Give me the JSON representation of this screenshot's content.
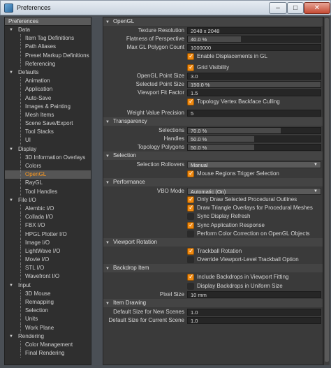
{
  "window": {
    "title": "Preferences",
    "min": "–",
    "max": "□",
    "close": "✕"
  },
  "sidebar": {
    "header": "Preferences",
    "tree": [
      {
        "label": "Data",
        "kind": "group"
      },
      {
        "label": "Item Tag Definitions",
        "kind": "child"
      },
      {
        "label": "Path Aliases",
        "kind": "child"
      },
      {
        "label": "Preset Markup Definitions",
        "kind": "child"
      },
      {
        "label": "Referencing",
        "kind": "child"
      },
      {
        "label": "Defaults",
        "kind": "group"
      },
      {
        "label": "Animation",
        "kind": "child"
      },
      {
        "label": "Application",
        "kind": "child"
      },
      {
        "label": "Auto-Save",
        "kind": "child"
      },
      {
        "label": "Images & Painting",
        "kind": "child"
      },
      {
        "label": "Mesh Items",
        "kind": "child"
      },
      {
        "label": "Scene Save/Export",
        "kind": "child"
      },
      {
        "label": "Tool Stacks",
        "kind": "child"
      },
      {
        "label": "UI",
        "kind": "child"
      },
      {
        "label": "Display",
        "kind": "group"
      },
      {
        "label": "3D Information Overlays",
        "kind": "child"
      },
      {
        "label": "Colors",
        "kind": "child"
      },
      {
        "label": "OpenGL",
        "kind": "child",
        "selected": true
      },
      {
        "label": "RayGL",
        "kind": "child"
      },
      {
        "label": "Tool Handles",
        "kind": "child"
      },
      {
        "label": "File I/O",
        "kind": "group"
      },
      {
        "label": "Alembic I/O",
        "kind": "child"
      },
      {
        "label": "Collada I/O",
        "kind": "child"
      },
      {
        "label": "FBX I/O",
        "kind": "child"
      },
      {
        "label": "HPGL Plotter I/O",
        "kind": "child"
      },
      {
        "label": "Image I/O",
        "kind": "child"
      },
      {
        "label": "LightWave I/O",
        "kind": "child"
      },
      {
        "label": "Movie I/O",
        "kind": "child"
      },
      {
        "label": "STL I/O",
        "kind": "child"
      },
      {
        "label": "Wavefront I/O",
        "kind": "child"
      },
      {
        "label": "Input",
        "kind": "group"
      },
      {
        "label": "3D Mouse",
        "kind": "child"
      },
      {
        "label": "Remapping",
        "kind": "child"
      },
      {
        "label": "Selection",
        "kind": "child"
      },
      {
        "label": "Units",
        "kind": "child"
      },
      {
        "label": "Work Plane",
        "kind": "child"
      },
      {
        "label": "Rendering",
        "kind": "group"
      },
      {
        "label": "Color Management",
        "kind": "child"
      },
      {
        "label": "Final Rendering",
        "kind": "child"
      }
    ]
  },
  "content": {
    "sections": [
      {
        "title": "OpenGL",
        "rows": [
          {
            "type": "field",
            "label": "Texture Resolution",
            "value": "2048 x 2048"
          },
          {
            "type": "pct",
            "label": "Flatness of Perspective",
            "value": "40.0 %",
            "fill": 0.4
          },
          {
            "type": "field",
            "label": "Max GL Polygon Count",
            "value": "1000000"
          },
          {
            "type": "check",
            "label": "Enable Displacements in GL",
            "checked": true
          },
          {
            "type": "gap"
          },
          {
            "type": "check",
            "label": "Grid Visibility",
            "checked": true
          },
          {
            "type": "field",
            "label": "OpenGL Point Size",
            "value": "3.0"
          },
          {
            "type": "pct",
            "label": "Selected Point Size",
            "value": "150.0 %",
            "fill": 1.0
          },
          {
            "type": "field",
            "label": "Viewport Fit Factor",
            "value": "1.5"
          },
          {
            "type": "check",
            "label": "Topology Vertex Backface Culling",
            "checked": true
          },
          {
            "type": "gap"
          },
          {
            "type": "field",
            "label": "Weight Value Precision",
            "value": "5"
          }
        ]
      },
      {
        "title": "Transparency",
        "rows": [
          {
            "type": "pct",
            "label": "Selections",
            "value": "70.0 %",
            "fill": 0.7
          },
          {
            "type": "pct",
            "label": "Handles",
            "value": "50.0 %",
            "fill": 0.5
          },
          {
            "type": "pct",
            "label": "Topology Polygons",
            "value": "50.0 %",
            "fill": 0.5
          }
        ]
      },
      {
        "title": "Selection",
        "rows": [
          {
            "type": "dropdown",
            "label": "Selection Rollovers",
            "value": "Manual"
          },
          {
            "type": "check",
            "label": "Mouse Regions Trigger Selection",
            "checked": true
          }
        ]
      },
      {
        "title": "Performance",
        "rows": [
          {
            "type": "dropdown",
            "label": "VBO Mode",
            "value": "Automatic (On)"
          },
          {
            "type": "check",
            "label": "Only Draw Selected Procedural Outlines",
            "checked": true
          },
          {
            "type": "check",
            "label": "Draw Triangle Overlays for Procedural Meshes",
            "checked": true
          },
          {
            "type": "check",
            "label": "Sync Display Refresh",
            "checked": false
          },
          {
            "type": "check",
            "label": "Sync Application Response",
            "checked": true
          },
          {
            "type": "check",
            "label": "Perform Color Correction on OpenGL Objects",
            "checked": false
          }
        ]
      },
      {
        "title": "Viewport Rotation",
        "rows": [
          {
            "type": "check",
            "label": "Trackball Rotation",
            "checked": true
          },
          {
            "type": "check",
            "label": "Override Viewport-Level Trackball Option",
            "checked": false
          }
        ]
      },
      {
        "title": "Backdrop Item",
        "rows": [
          {
            "type": "check",
            "label": "Include Backdrops in Viewport Fitting",
            "checked": true
          },
          {
            "type": "check",
            "label": "Display Backdrops in Uniform Size",
            "checked": false
          },
          {
            "type": "field",
            "label": "Pixel Size",
            "value": "10 mm"
          }
        ]
      },
      {
        "title": "Item Drawing",
        "rows": [
          {
            "type": "field",
            "label": "Default Size for New Scenes",
            "value": "1.0"
          },
          {
            "type": "field",
            "label": "Default Size for Current Scene",
            "value": "1.0"
          }
        ]
      }
    ]
  }
}
